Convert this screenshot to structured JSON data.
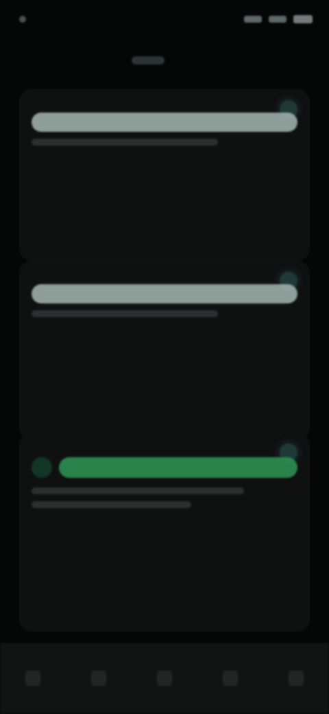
{
  "status_bar": {
    "time": "",
    "icons": [
      "signal-icon",
      "wifi-icon",
      "battery-icon"
    ]
  },
  "header": {
    "title": "",
    "center_icon": "app-logo-icon"
  },
  "cards": [
    {
      "title": "",
      "subtitle": "",
      "status_color": "#1f3a36",
      "primary_bar_color": "#a5b7b2"
    },
    {
      "title": "",
      "subtitle": "",
      "status_color": "#1f3a36",
      "primary_bar_color": "#a5b7b2"
    },
    {
      "title": "",
      "subtitle": "",
      "status_color": "#1f3a36",
      "primary_bar_color": "#2b8a4e"
    }
  ],
  "bottom_nav": {
    "items": [
      {
        "icon": "home-icon"
      },
      {
        "icon": "search-icon"
      },
      {
        "icon": "grid-icon"
      },
      {
        "icon": "bell-icon"
      },
      {
        "icon": "profile-icon"
      }
    ]
  }
}
